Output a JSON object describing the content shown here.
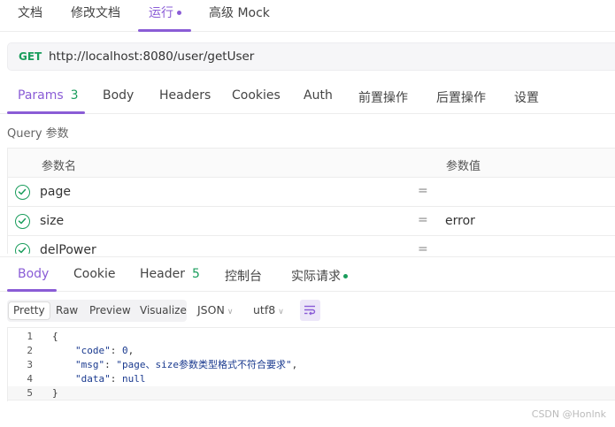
{
  "top_tabs": [
    {
      "label": "文档"
    },
    {
      "label": "修改文档"
    },
    {
      "label": "运行"
    },
    {
      "label": "高级 Mock"
    }
  ],
  "request": {
    "method": "GET",
    "url": "http://localhost:8080/user/getUser"
  },
  "request_tabs": {
    "params_label": "Params",
    "params_count": "3",
    "body": "Body",
    "headers": "Headers",
    "cookies": "Cookies",
    "auth": "Auth",
    "pre_ops": "前置操作",
    "post_ops": "后置操作",
    "settings": "设置"
  },
  "query_section_label": "Query 参数",
  "params_table": {
    "header_name": "参数名",
    "header_value": "参数值",
    "rows": [
      {
        "name": "page",
        "eq": "=",
        "value": "",
        "enabled": true
      },
      {
        "name": "size",
        "eq": "=",
        "value": "error",
        "enabled": true
      },
      {
        "name": "delPower",
        "eq": "=",
        "value": "",
        "enabled": true
      }
    ]
  },
  "response_tabs": {
    "body": "Body",
    "cookie": "Cookie",
    "header_label": "Header",
    "header_count": "5",
    "console": "控制台",
    "actual_request": "实际请求"
  },
  "format_bar": {
    "modes": [
      "Pretty",
      "Raw",
      "Preview",
      "Visualize"
    ],
    "active_mode": "Pretty",
    "language": "JSON",
    "encoding": "utf8"
  },
  "response_body": {
    "line_numbers": [
      "1",
      "2",
      "3",
      "4",
      "5"
    ],
    "open_brace": "{",
    "code_key": "\"code\"",
    "code_value": "0",
    "msg_key": "\"msg\"",
    "msg_value": "\"page、size参数类型格式不符合要求\"",
    "data_key": "\"data\"",
    "data_value": "null",
    "close_brace": "}"
  },
  "watermark": "CSDN @Honlnk",
  "colors": {
    "accent": "#8a5cd6",
    "get_method": "#1a9d5c",
    "check": "#1a9d5c"
  }
}
